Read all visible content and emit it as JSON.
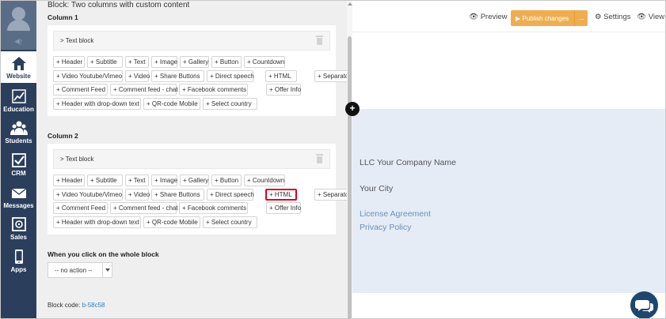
{
  "nav": {
    "items": [
      {
        "label": "Website",
        "icon": "home-icon",
        "active": true
      },
      {
        "label": "Education",
        "icon": "chart-icon"
      },
      {
        "label": "Students",
        "icon": "students-icon"
      },
      {
        "label": "CRM",
        "icon": "checkbox-icon"
      },
      {
        "label": "Messages",
        "icon": "envelope-icon"
      },
      {
        "label": "Sales",
        "icon": "safe-icon"
      },
      {
        "label": "Apps",
        "icon": "mobile-icon"
      }
    ]
  },
  "editor": {
    "block_title": "Block: Two columns with custom content",
    "column1": {
      "title": "Column 1",
      "text_block": "> Text block",
      "buttons": [
        "+ Header",
        "+ Subtitle",
        "+ Text",
        "+ Image",
        "+ Gallery",
        "+ Button",
        "+ Countdown",
        "+ Video Youtube/Vimeo",
        "+ Video",
        "+ Share Buttons",
        "+ Direct speech",
        "+ HTML",
        "+ Separator",
        "+ Comment Feed",
        "+ Comment feed - chat",
        "+ Facebook comments",
        "+ Offer Info",
        "+ Header with drop-down text",
        "+ QR-code Mobile",
        "+ Select country"
      ]
    },
    "column2": {
      "title": "Column 2",
      "text_block": "> Text block",
      "buttons": [
        "+ Header",
        "+ Subtitle",
        "+ Text",
        "+ Image",
        "+ Gallery",
        "+ Button",
        "+ Countdown",
        "+ Video Youtube/Vimeo",
        "+ Video",
        "+ Share Buttons",
        "+ Direct speech",
        "+ HTML",
        "+ Separator",
        "+ Comment Feed",
        "+ Comment feed - chat",
        "+ Facebook comments",
        "+ Offer Info",
        "+ Header with drop-down text",
        "+ QR-code Mobile",
        "+ Select country"
      ],
      "highlighted": "+ HTML"
    },
    "click_title": "When you click on the whole block",
    "click_action": "-- no action --",
    "block_code_label": "Block code:",
    "block_code": "b-58c58"
  },
  "toolbar": {
    "preview": "Preview",
    "publish": "Publish changes",
    "publish_more": "...",
    "settings": "Settings",
    "view": "View"
  },
  "footer": {
    "company": "LLC Your Company Name",
    "city": "Your City",
    "links": [
      "License Agreement",
      "Privacy Policy"
    ]
  },
  "colors": {
    "nav_bg": "#2b3f5c",
    "publish": "#f0ad4e",
    "footer_bg": "#e5ecf6",
    "highlight": "#e0001b",
    "link": "#6b8fb8"
  }
}
